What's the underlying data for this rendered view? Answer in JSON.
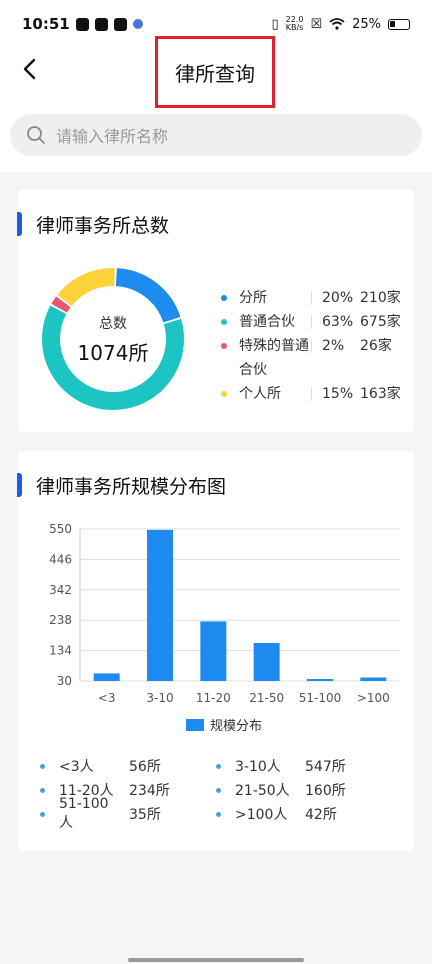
{
  "status": {
    "time": "10:51",
    "speed_top": "22.0",
    "speed_bottom": "KB/s",
    "battery": "25%"
  },
  "header": {
    "title": "律所查询"
  },
  "search": {
    "placeholder": "请输入律所名称"
  },
  "summary": {
    "title": "律师事务所总数",
    "center_label": "总数",
    "center_value": "1074所",
    "items": [
      {
        "name": "分所",
        "pct": "20%",
        "count": "210家",
        "color": "#1e8bf0"
      },
      {
        "name": "普通合伙",
        "pct": "63%",
        "count": "675家",
        "color": "#1cc4c4"
      },
      {
        "name": "特殊的普通合伙",
        "pct": "2%",
        "count": "26家",
        "color": "#e8566e"
      },
      {
        "name": "个人所",
        "pct": "15%",
        "count": "163家",
        "color": "#fcd23a"
      }
    ]
  },
  "distribution": {
    "title": "律师事务所规模分布图",
    "legend_label": "规模分布",
    "items": [
      {
        "name": "<3人",
        "value": "56所"
      },
      {
        "name": "3-10人",
        "value": "547所"
      },
      {
        "name": "11-20人",
        "value": "234所"
      },
      {
        "name": "21-50人",
        "value": "160所"
      },
      {
        "name": "51-100人",
        "value": "35所"
      },
      {
        "name": ">100人",
        "value": "42所"
      }
    ]
  },
  "chart_data": [
    {
      "type": "pie",
      "categories": [
        "分所",
        "普通合伙",
        "特殊的普通合伙",
        "个人所"
      ],
      "values": [
        210,
        675,
        26,
        163
      ],
      "colors": [
        "#1e8bf0",
        "#1cc4c4",
        "#e8566e",
        "#fcd23a"
      ]
    },
    {
      "type": "bar",
      "categories": [
        "<3",
        "3-10",
        "11-20",
        "21-50",
        "51-100",
        ">100"
      ],
      "series": [
        {
          "name": "规模分布",
          "values": [
            56,
            547,
            234,
            160,
            35,
            42
          ],
          "color": "#1e8bf0"
        }
      ],
      "yticks": [
        "550",
        "446",
        "342",
        "238",
        "134",
        "30"
      ],
      "ylim": [
        30,
        550
      ],
      "grid": true,
      "legend": "bottom"
    }
  ]
}
